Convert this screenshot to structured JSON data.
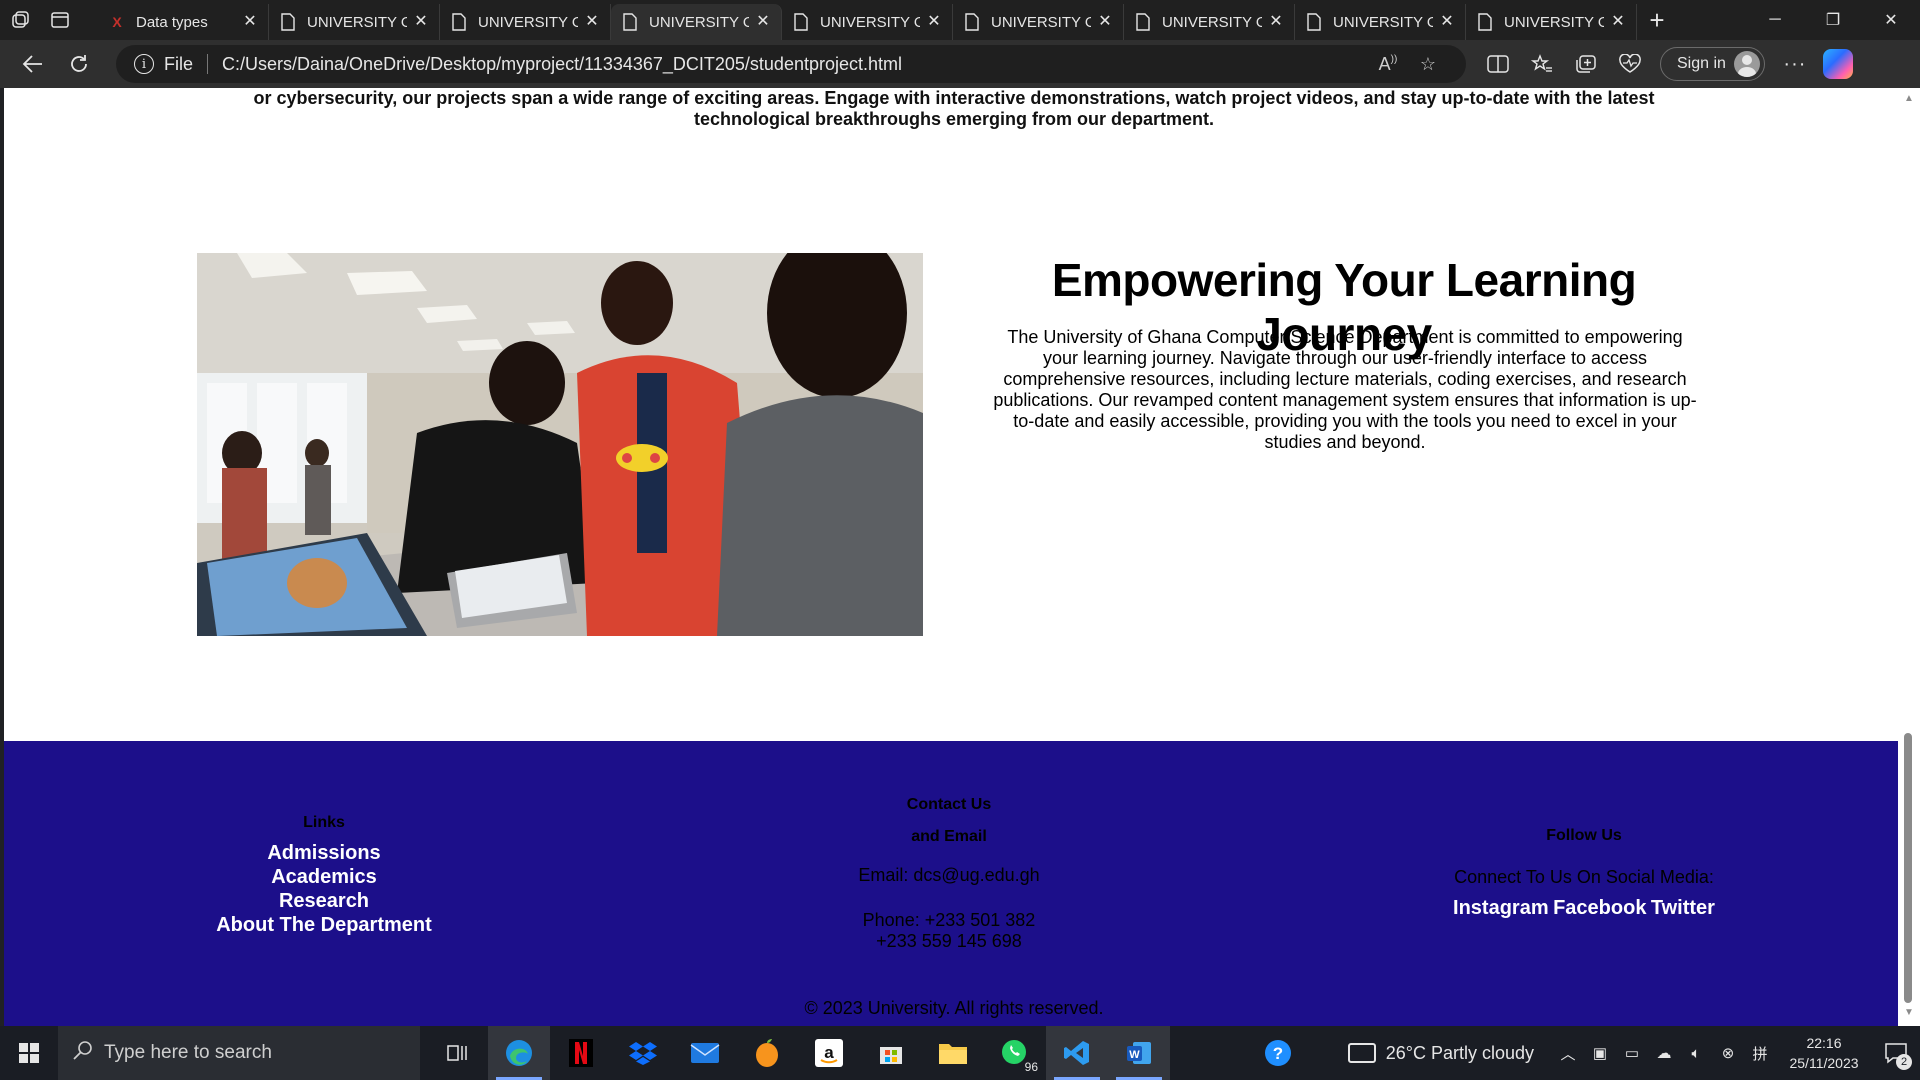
{
  "browser": {
    "tabs": [
      {
        "title": "Data types",
        "favicon": "x-brand-icon"
      },
      {
        "title": "UNIVERSITY OF GHANA",
        "favicon": "page-icon"
      },
      {
        "title": "UNIVERSITY OF GHANA",
        "favicon": "page-icon"
      },
      {
        "title": "UNIVERSITY OF GHANA",
        "favicon": "page-icon",
        "active": true
      },
      {
        "title": "UNIVERSITY OF GHANA",
        "favicon": "page-icon"
      },
      {
        "title": "UNIVERSITY OF GHANA",
        "favicon": "page-icon"
      },
      {
        "title": "UNIVERSITY OF GHANA",
        "favicon": "page-icon"
      },
      {
        "title": "UNIVERSITY OF GHANA",
        "favicon": "page-icon"
      },
      {
        "title": "UNIVERSITY OF GHANA",
        "favicon": "page-icon"
      }
    ],
    "address": {
      "scheme_label": "File",
      "url": "C:/Users/Daina/OneDrive/Desktop/myproject/11334367_DCIT205/studentproject.html"
    },
    "signin_label": "Sign in"
  },
  "page": {
    "intro_text": "or cybersecurity, our projects span a wide range of exciting areas. Engage with interactive demonstrations, watch project videos, and stay up-to-date with the latest technological breakthroughs emerging from our department.",
    "section": {
      "title": "Empowering Your Learning Journey",
      "body": "The University of Ghana Computer Science Department is committed to empowering your learning journey. Navigate through our user-friendly interface to access comprehensive resources, including lecture materials, coding exercises, and research publications. Our revamped content management system ensures that information is up-to-date and easily accessible, providing you with the tools you need to excel in your studies and beyond."
    },
    "footer": {
      "links_heading": "Links",
      "links": [
        "Admissions",
        "Academics",
        "Research",
        "About The Department"
      ],
      "contact_heading_line1": "Contact Us",
      "contact_heading_line2": "and Email",
      "email": "Email: dcs@ug.edu.gh",
      "phone_line1": "Phone: +233 501 382",
      "phone_line2": "+233 559 145 698",
      "follow_heading": "Follow Us",
      "social_prompt": "Connect To Us On Social Media:",
      "social_links": [
        "Instagram",
        "Facebook",
        "Twitter"
      ],
      "copyright": "© 2023 University. All rights reserved."
    }
  },
  "taskbar": {
    "search_placeholder": "Type here to search",
    "apps": [
      "task-view-icon",
      "edge-icon",
      "netflix-icon",
      "dropbox-icon",
      "mail-icon",
      "fl-studio-icon",
      "amazon-icon",
      "microsoft-store-icon",
      "file-explorer-icon",
      "whatsapp-icon",
      "vscode-icon",
      "word-icon"
    ],
    "whatsapp_badge": "96",
    "weather": "26°C  Partly cloudy",
    "time": "22:16",
    "date": "25/11/2023",
    "notification_count": "2"
  },
  "colors": {
    "footer_bg": "#1c0f8a",
    "footer_link": "#ffffff",
    "accent_link": "#7aa7ff"
  }
}
